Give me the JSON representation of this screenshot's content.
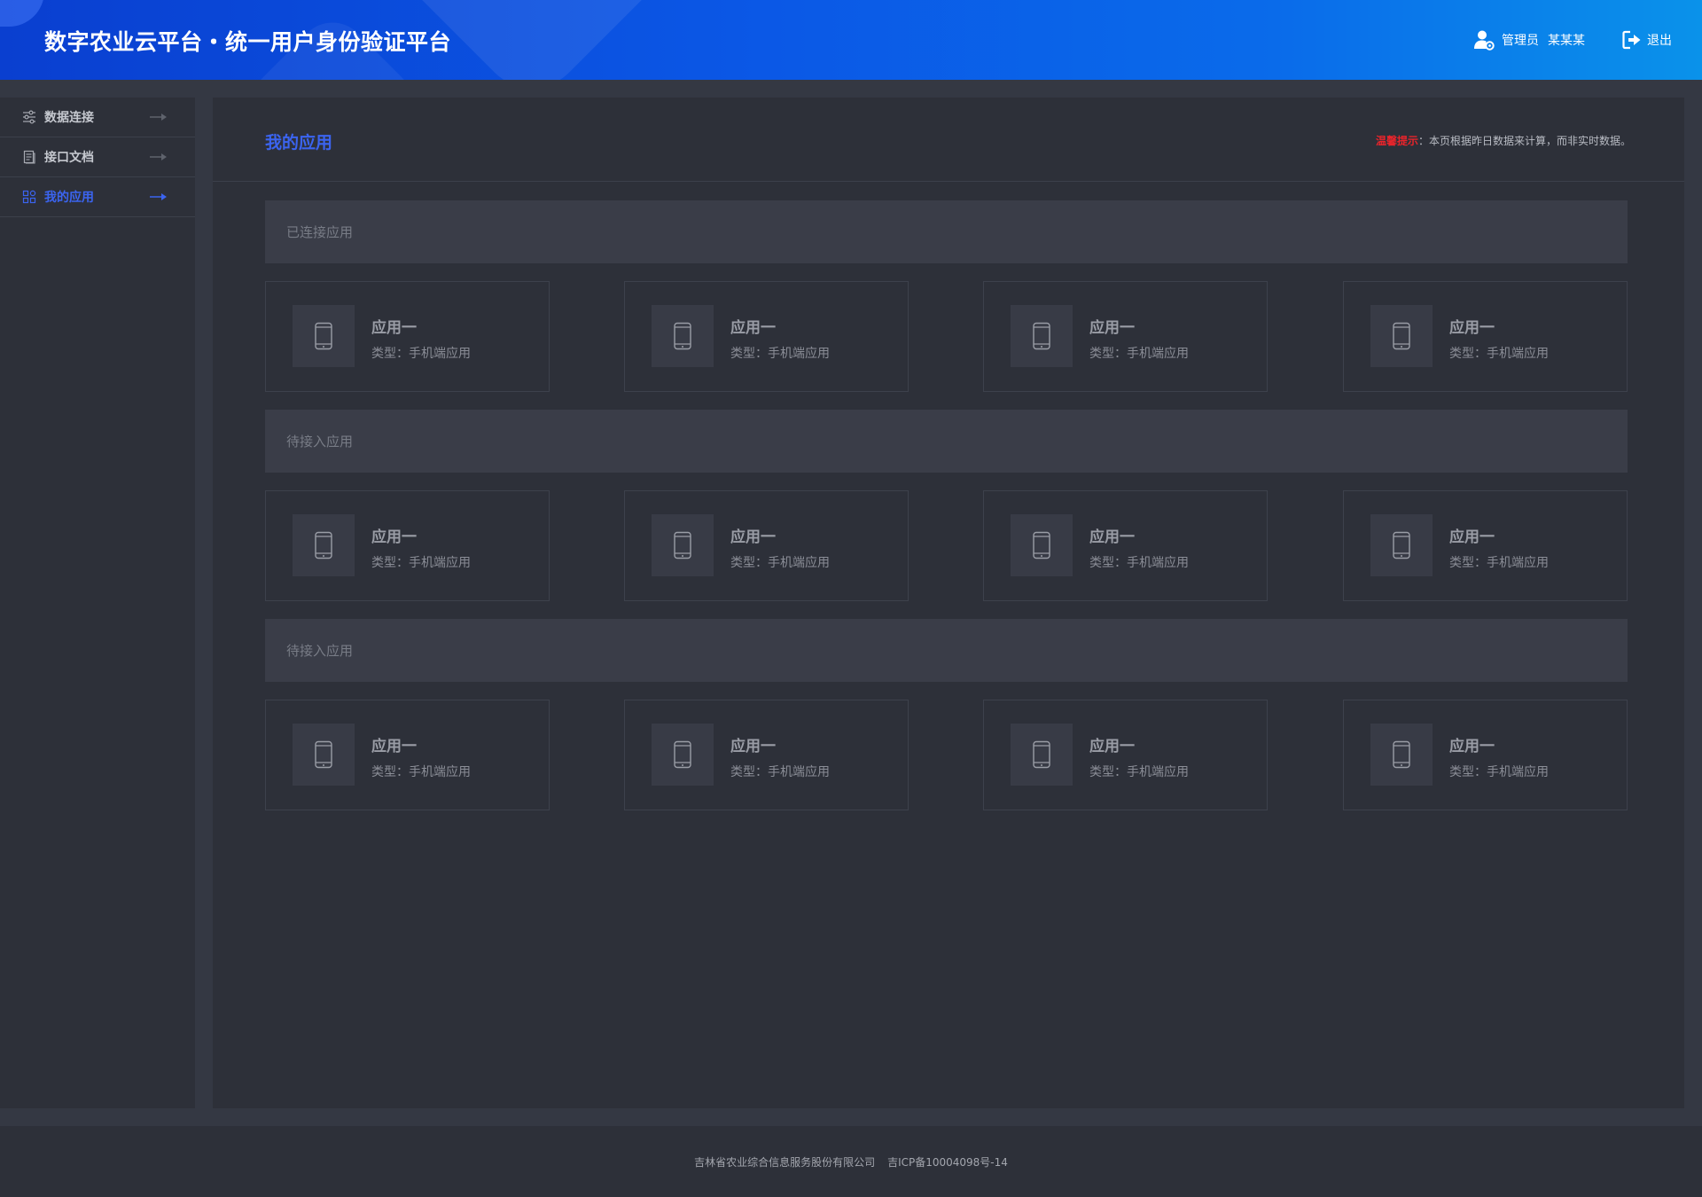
{
  "header": {
    "title": "数字农业云平台・统一用户身份验证平台",
    "role": "管理员",
    "username": "某某某",
    "logout_label": "退出"
  },
  "sidebar": {
    "items": [
      {
        "label": "数据连接",
        "icon": "sliders-icon",
        "active": false
      },
      {
        "label": "接口文档",
        "icon": "document-icon",
        "active": false
      },
      {
        "label": "我的应用",
        "icon": "apps-grid-icon",
        "active": true
      }
    ]
  },
  "main": {
    "title": "我的应用",
    "notice_highlight": "温馨提示",
    "notice_text": "：本页根据昨日数据来计算，而非实时数据。",
    "sections": [
      {
        "title": "已连接应用",
        "apps": [
          {
            "name": "应用一",
            "type": "类型：手机端应用"
          },
          {
            "name": "应用一",
            "type": "类型：手机端应用"
          },
          {
            "name": "应用一",
            "type": "类型：手机端应用"
          },
          {
            "name": "应用一",
            "type": "类型：手机端应用"
          }
        ]
      },
      {
        "title": "待接入应用",
        "apps": [
          {
            "name": "应用一",
            "type": "类型：手机端应用"
          },
          {
            "name": "应用一",
            "type": "类型：手机端应用"
          },
          {
            "name": "应用一",
            "type": "类型：手机端应用"
          },
          {
            "name": "应用一",
            "type": "类型：手机端应用"
          }
        ]
      },
      {
        "title": "待接入应用",
        "apps": [
          {
            "name": "应用一",
            "type": "类型：手机端应用"
          },
          {
            "name": "应用一",
            "type": "类型：手机端应用"
          },
          {
            "name": "应用一",
            "type": "类型：手机端应用"
          },
          {
            "name": "应用一",
            "type": "类型：手机端应用"
          }
        ]
      }
    ]
  },
  "footer": {
    "company": "吉林省农业综合信息服务股份有限公司",
    "icp": "吉ICP备10004098号-14"
  },
  "colors": {
    "accent": "#3b64f0",
    "notice": "#e8242b",
    "header_start": "#0a3fd0",
    "header_end": "#0a92ea",
    "panel": "#2d3039",
    "background": "#343843"
  }
}
